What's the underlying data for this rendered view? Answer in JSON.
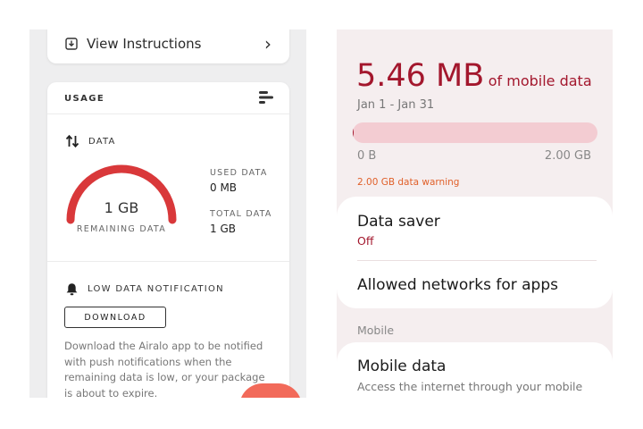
{
  "airalo": {
    "instructions": {
      "label": "View Instructions",
      "chevron": "›"
    },
    "usage": {
      "title": "USAGE",
      "data_label": "DATA",
      "remaining_value": "1 GB",
      "remaining_label": "REMAINING DATA",
      "remaining_fraction": 1.0,
      "used_label": "USED DATA",
      "used_value": "0 MB",
      "total_label": "TOTAL DATA",
      "total_value": "1 GB",
      "gauge_color": "#d9383a"
    },
    "notification": {
      "title": "LOW DATA NOTIFICATION",
      "button_label": "DOWNLOAD",
      "description": "Download the Airalo app to be notified with push notifications when the remaining data is low, or your package is about to expire."
    },
    "fab_color": "#f26a5a"
  },
  "android": {
    "usage_amount": "5.46 MB",
    "usage_suffix": "of mobile data",
    "date_range": "Jan 1 - Jan 31",
    "bar": {
      "min_label": "0 B",
      "max_label": "2.00 GB",
      "fill_fraction": 0.003
    },
    "warning": "2.00 GB data warning",
    "data_saver": {
      "title": "Data saver",
      "status": "Off"
    },
    "allowed_networks": {
      "title": "Allowed networks for apps"
    },
    "section_mobile": "Mobile",
    "mobile_data": {
      "title": "Mobile data",
      "subtitle": "Access the internet through your mobile network"
    },
    "accent_color": "#a3172d",
    "warning_color": "#e0602a"
  }
}
